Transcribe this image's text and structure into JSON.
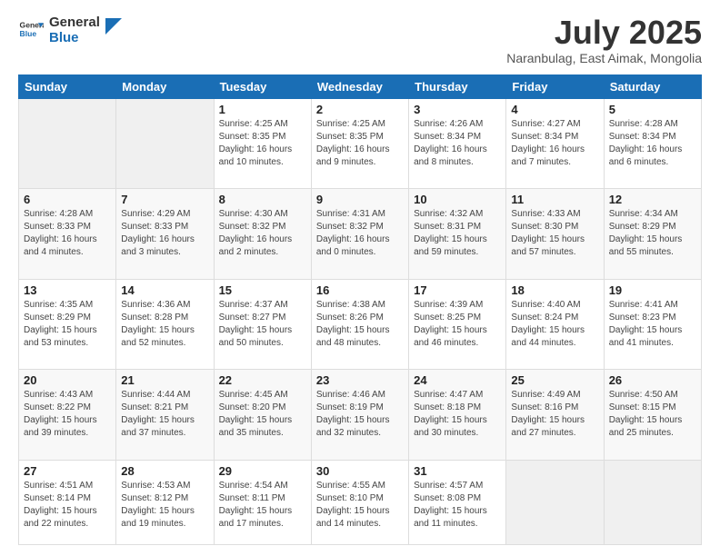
{
  "header": {
    "logo_text_general": "General",
    "logo_text_blue": "Blue",
    "month_year": "July 2025",
    "location": "Naranbulag, East Aimak, Mongolia"
  },
  "days_of_week": [
    "Sunday",
    "Monday",
    "Tuesday",
    "Wednesday",
    "Thursday",
    "Friday",
    "Saturday"
  ],
  "weeks": [
    [
      {
        "day": "",
        "detail": ""
      },
      {
        "day": "",
        "detail": ""
      },
      {
        "day": "1",
        "detail": "Sunrise: 4:25 AM\nSunset: 8:35 PM\nDaylight: 16 hours\nand 10 minutes."
      },
      {
        "day": "2",
        "detail": "Sunrise: 4:25 AM\nSunset: 8:35 PM\nDaylight: 16 hours\nand 9 minutes."
      },
      {
        "day": "3",
        "detail": "Sunrise: 4:26 AM\nSunset: 8:34 PM\nDaylight: 16 hours\nand 8 minutes."
      },
      {
        "day": "4",
        "detail": "Sunrise: 4:27 AM\nSunset: 8:34 PM\nDaylight: 16 hours\nand 7 minutes."
      },
      {
        "day": "5",
        "detail": "Sunrise: 4:28 AM\nSunset: 8:34 PM\nDaylight: 16 hours\nand 6 minutes."
      }
    ],
    [
      {
        "day": "6",
        "detail": "Sunrise: 4:28 AM\nSunset: 8:33 PM\nDaylight: 16 hours\nand 4 minutes."
      },
      {
        "day": "7",
        "detail": "Sunrise: 4:29 AM\nSunset: 8:33 PM\nDaylight: 16 hours\nand 3 minutes."
      },
      {
        "day": "8",
        "detail": "Sunrise: 4:30 AM\nSunset: 8:32 PM\nDaylight: 16 hours\nand 2 minutes."
      },
      {
        "day": "9",
        "detail": "Sunrise: 4:31 AM\nSunset: 8:32 PM\nDaylight: 16 hours\nand 0 minutes."
      },
      {
        "day": "10",
        "detail": "Sunrise: 4:32 AM\nSunset: 8:31 PM\nDaylight: 15 hours\nand 59 minutes."
      },
      {
        "day": "11",
        "detail": "Sunrise: 4:33 AM\nSunset: 8:30 PM\nDaylight: 15 hours\nand 57 minutes."
      },
      {
        "day": "12",
        "detail": "Sunrise: 4:34 AM\nSunset: 8:29 PM\nDaylight: 15 hours\nand 55 minutes."
      }
    ],
    [
      {
        "day": "13",
        "detail": "Sunrise: 4:35 AM\nSunset: 8:29 PM\nDaylight: 15 hours\nand 53 minutes."
      },
      {
        "day": "14",
        "detail": "Sunrise: 4:36 AM\nSunset: 8:28 PM\nDaylight: 15 hours\nand 52 minutes."
      },
      {
        "day": "15",
        "detail": "Sunrise: 4:37 AM\nSunset: 8:27 PM\nDaylight: 15 hours\nand 50 minutes."
      },
      {
        "day": "16",
        "detail": "Sunrise: 4:38 AM\nSunset: 8:26 PM\nDaylight: 15 hours\nand 48 minutes."
      },
      {
        "day": "17",
        "detail": "Sunrise: 4:39 AM\nSunset: 8:25 PM\nDaylight: 15 hours\nand 46 minutes."
      },
      {
        "day": "18",
        "detail": "Sunrise: 4:40 AM\nSunset: 8:24 PM\nDaylight: 15 hours\nand 44 minutes."
      },
      {
        "day": "19",
        "detail": "Sunrise: 4:41 AM\nSunset: 8:23 PM\nDaylight: 15 hours\nand 41 minutes."
      }
    ],
    [
      {
        "day": "20",
        "detail": "Sunrise: 4:43 AM\nSunset: 8:22 PM\nDaylight: 15 hours\nand 39 minutes."
      },
      {
        "day": "21",
        "detail": "Sunrise: 4:44 AM\nSunset: 8:21 PM\nDaylight: 15 hours\nand 37 minutes."
      },
      {
        "day": "22",
        "detail": "Sunrise: 4:45 AM\nSunset: 8:20 PM\nDaylight: 15 hours\nand 35 minutes."
      },
      {
        "day": "23",
        "detail": "Sunrise: 4:46 AM\nSunset: 8:19 PM\nDaylight: 15 hours\nand 32 minutes."
      },
      {
        "day": "24",
        "detail": "Sunrise: 4:47 AM\nSunset: 8:18 PM\nDaylight: 15 hours\nand 30 minutes."
      },
      {
        "day": "25",
        "detail": "Sunrise: 4:49 AM\nSunset: 8:16 PM\nDaylight: 15 hours\nand 27 minutes."
      },
      {
        "day": "26",
        "detail": "Sunrise: 4:50 AM\nSunset: 8:15 PM\nDaylight: 15 hours\nand 25 minutes."
      }
    ],
    [
      {
        "day": "27",
        "detail": "Sunrise: 4:51 AM\nSunset: 8:14 PM\nDaylight: 15 hours\nand 22 minutes."
      },
      {
        "day": "28",
        "detail": "Sunrise: 4:53 AM\nSunset: 8:12 PM\nDaylight: 15 hours\nand 19 minutes."
      },
      {
        "day": "29",
        "detail": "Sunrise: 4:54 AM\nSunset: 8:11 PM\nDaylight: 15 hours\nand 17 minutes."
      },
      {
        "day": "30",
        "detail": "Sunrise: 4:55 AM\nSunset: 8:10 PM\nDaylight: 15 hours\nand 14 minutes."
      },
      {
        "day": "31",
        "detail": "Sunrise: 4:57 AM\nSunset: 8:08 PM\nDaylight: 15 hours\nand 11 minutes."
      },
      {
        "day": "",
        "detail": ""
      },
      {
        "day": "",
        "detail": ""
      }
    ]
  ]
}
